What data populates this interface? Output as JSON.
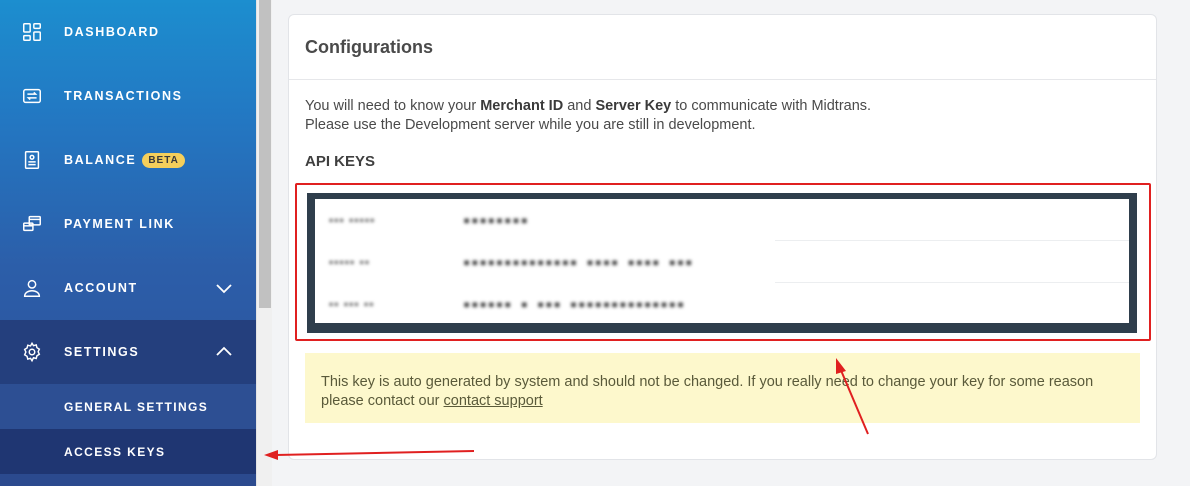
{
  "sidebar": {
    "items": [
      {
        "label": "DASHBOARD",
        "icon": "dashboard-icon"
      },
      {
        "label": "TRANSACTIONS",
        "icon": "transactions-icon"
      },
      {
        "label": "BALANCE",
        "icon": "balance-icon",
        "badge": "BETA"
      },
      {
        "label": "PAYMENT LINK",
        "icon": "payment-link-icon"
      },
      {
        "label": "ACCOUNT",
        "icon": "user-icon",
        "expanded": false
      },
      {
        "label": "SETTINGS",
        "icon": "gear-icon",
        "expanded": true
      }
    ],
    "settings_subitems": [
      {
        "label": "GENERAL SETTINGS"
      },
      {
        "label": "ACCESS KEYS",
        "active": true
      }
    ]
  },
  "card": {
    "title": "Configurations",
    "desc_line1_pre": "You will need to know your ",
    "merchant_id": "Merchant ID",
    "desc_and": " and ",
    "server_key": "Server Key",
    "desc_line1_post": " to communicate with Midtrans.",
    "desc_line2": "Please use the Development server while you are still in development.",
    "api_heading": "API KEYS",
    "api_keys": [
      {
        "name": "▪▪▪ ▪▪▪▪▪",
        "value": "▪▪▪▪▪▪▪▪"
      },
      {
        "name": "▪▪▪▪▪ ▪▪",
        "value": "▪▪▪▪▪▪▪▪▪▪▪▪▪▪ ▪▪▪▪ ▪▪▪▪ ▪▪▪"
      },
      {
        "name": "▪▪ ▪▪▪ ▪▪",
        "value": "▪▪▪▪▪▪ ▪ ▪▪▪ ▪▪▪▪▪▪▪▪▪▪▪▪▪▪"
      }
    ],
    "notice_text": "This key is auto generated by system and should not be changed. If you really need to change your key for some reason please contact our ",
    "contact_link": "contact support"
  },
  "colors": {
    "sidebar_top": "#1c8ecf",
    "sidebar_bottom": "#2a4d96",
    "badge": "#f5cf5b",
    "annotation": "#e02020",
    "notice_bg": "#fdf8cc",
    "keys_frame": "#2f3e4c"
  }
}
